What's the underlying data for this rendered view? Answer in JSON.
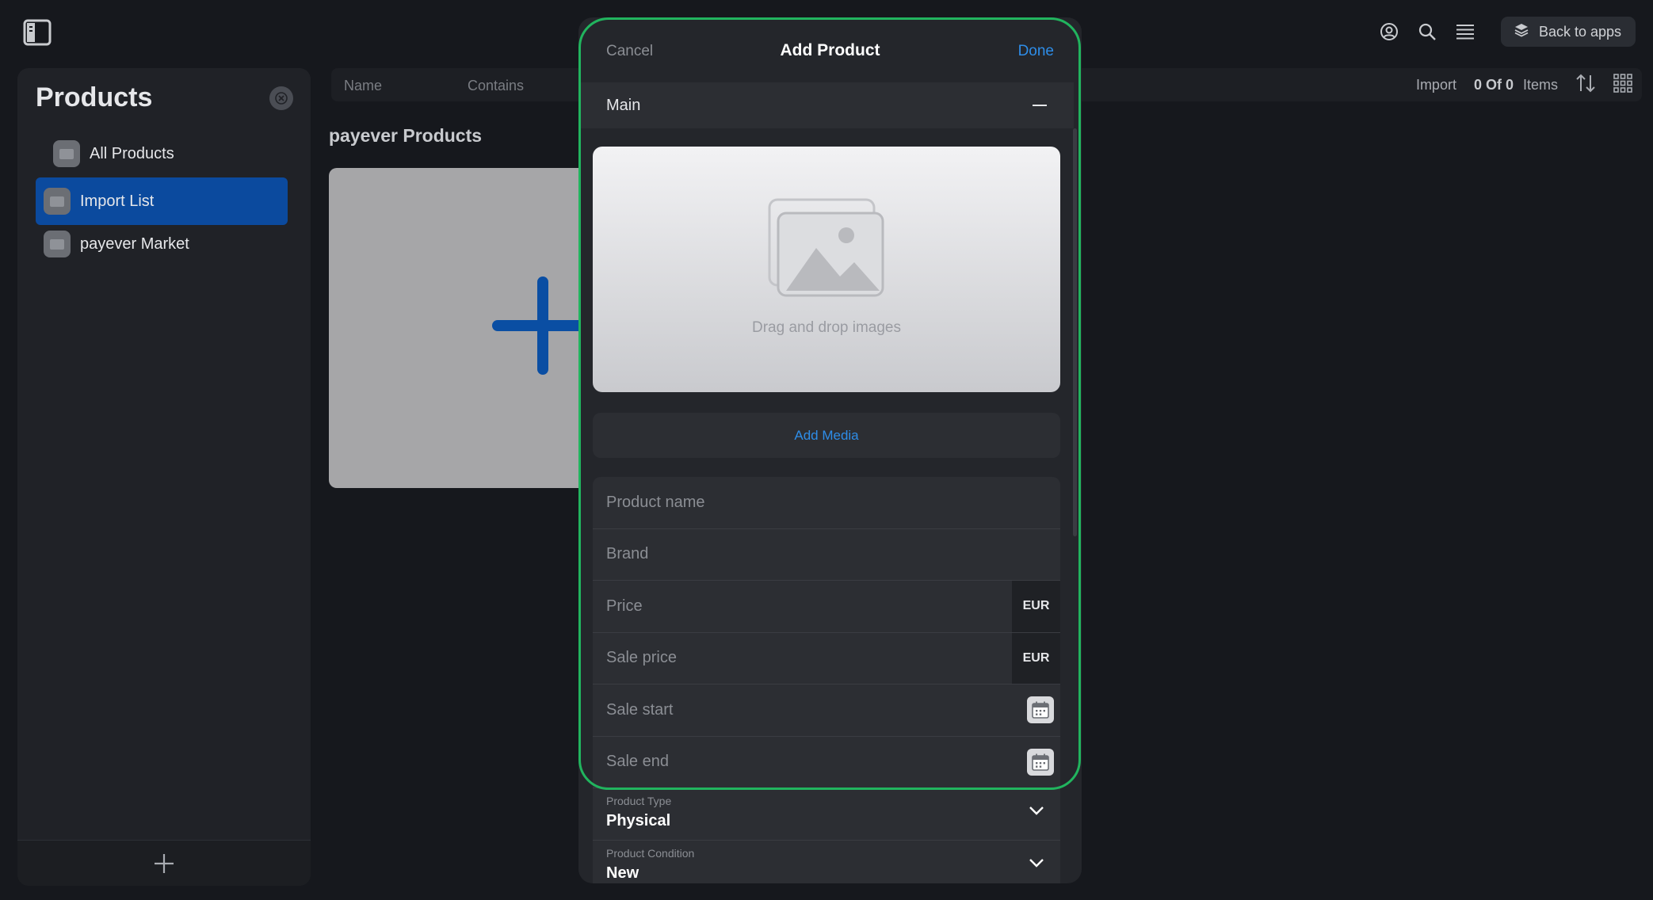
{
  "topbar": {
    "sidebar_toggle_icon": "sidebar-toggle-icon",
    "icons": [
      "user-circle-icon",
      "search-icon",
      "menu-icon"
    ],
    "back_label": "Back to apps"
  },
  "sidebar": {
    "title": "Products",
    "items": [
      {
        "label": "All Products",
        "active": false
      },
      {
        "label": "Import List",
        "active": true
      },
      {
        "label": "payever Market",
        "active": false
      }
    ]
  },
  "filterbar": {
    "name_label": "Name",
    "contains_label": "Contains"
  },
  "toolbar": {
    "import_label": "Import",
    "count": "0 Of 0",
    "items_label": "Items"
  },
  "main": {
    "section_title": "payever Products"
  },
  "modal": {
    "cancel": "Cancel",
    "title": "Add Product",
    "done": "Done",
    "section": "Main",
    "drop_text": "Drag and drop images",
    "add_media": "Add Media",
    "fields": {
      "product_name": "Product name",
      "brand": "Brand",
      "price": "Price",
      "price_currency": "EUR",
      "sale_price": "Sale price",
      "sale_price_currency": "EUR",
      "sale_start": "Sale start",
      "sale_end": "Sale end"
    },
    "product_type": {
      "label": "Product Type",
      "value": "Physical"
    },
    "product_condition": {
      "label": "Product Condition",
      "value": "New"
    }
  },
  "colors": {
    "accent": "#2e8de8",
    "active_nav": "#0b4a9e",
    "highlight": "#21b45e"
  }
}
